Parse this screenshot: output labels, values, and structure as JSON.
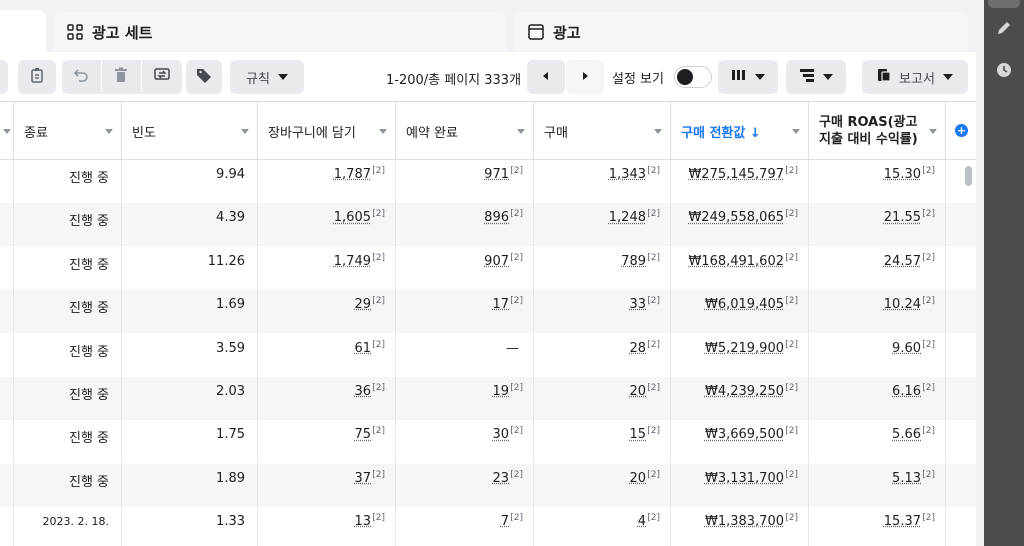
{
  "tabs": {
    "adsets_label": "광고 세트",
    "ads_label": "광고"
  },
  "toolbar": {
    "rules_label": "규칙",
    "pagination_text": "1-200/총 페이지 333개",
    "view_settings_label": "설정 보기",
    "reports_label": "보고서"
  },
  "columns": [
    {
      "label": "종료"
    },
    {
      "label": "빈도"
    },
    {
      "label": "장바구니에 담기"
    },
    {
      "label": "예약 완료"
    },
    {
      "label": "구매"
    },
    {
      "label": "구매 전환값 ↓"
    },
    {
      "label_line1": "구매 ROAS(광고",
      "label_line2": "지출 대비 수익률)"
    }
  ],
  "rows": [
    {
      "status": "진행 중",
      "frequency": "9.94",
      "cart": "1,787",
      "booking": "971",
      "purchase": "1,343",
      "value": "₩275,145,797",
      "roas": "15.30"
    },
    {
      "status": "진행 중",
      "frequency": "4.39",
      "cart": "1,605",
      "booking": "896",
      "purchase": "1,248",
      "value": "₩249,558,065",
      "roas": "21.55"
    },
    {
      "status": "진행 중",
      "frequency": "11.26",
      "cart": "1,749",
      "booking": "907",
      "purchase": "789",
      "value": "₩168,491,602",
      "roas": "24.57"
    },
    {
      "status": "진행 중",
      "frequency": "1.69",
      "cart": "29",
      "booking": "17",
      "purchase": "33",
      "value": "₩6,019,405",
      "roas": "10.24"
    },
    {
      "status": "진행 중",
      "frequency": "3.59",
      "cart": "61",
      "booking": "—",
      "purchase": "28",
      "value": "₩5,219,900",
      "roas": "9.60"
    },
    {
      "status": "진행 중",
      "frequency": "2.03",
      "cart": "36",
      "booking": "19",
      "purchase": "20",
      "value": "₩4,239,250",
      "roas": "6.16"
    },
    {
      "status": "진행 중",
      "frequency": "1.75",
      "cart": "75",
      "booking": "30",
      "purchase": "15",
      "value": "₩3,669,500",
      "roas": "5.66"
    },
    {
      "status": "진행 중",
      "frequency": "1.89",
      "cart": "37",
      "booking": "23",
      "purchase": "20",
      "value": "₩3,131,700",
      "roas": "5.13"
    },
    {
      "status": "2023. 2. 18.",
      "frequency": "1.33",
      "cart": "13",
      "booking": "7",
      "purchase": "4",
      "value": "₩1,383,700",
      "roas": "15.37"
    }
  ],
  "footnote_marker": "[2]",
  "colors": {
    "accent": "#1877f2",
    "rail": "#4b4c4f"
  },
  "icons": [
    "grid-icon",
    "window-icon",
    "clipboard-icon",
    "undo-icon",
    "trash-icon",
    "swap-icon",
    "tag-icon",
    "prev-icon",
    "next-icon",
    "columns-icon",
    "breakdown-icon",
    "report-icon",
    "pencil-icon",
    "clock-icon",
    "add-column-icon"
  ]
}
